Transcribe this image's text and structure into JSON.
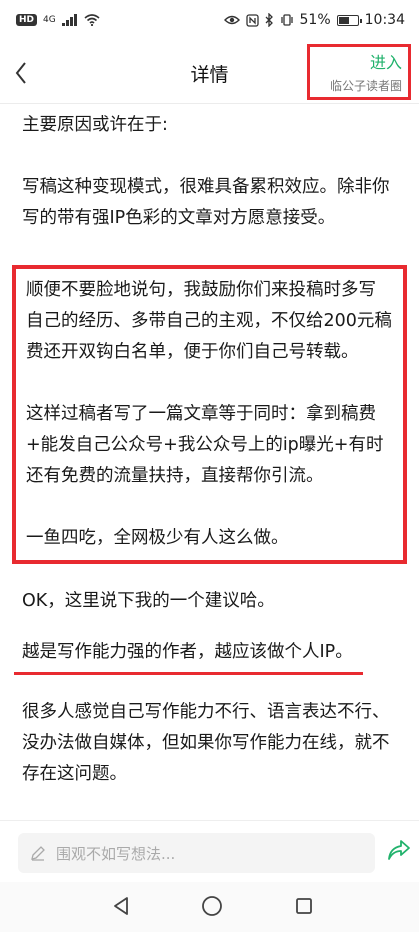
{
  "status_bar": {
    "hd": "HD",
    "network": "4G",
    "battery_percent": "51%",
    "time": "10:34"
  },
  "header": {
    "title": "详情",
    "enter_label": "进入",
    "circle_name": "临公子读者圈"
  },
  "article": {
    "p1": "主要原因或许在于:",
    "p2": "写稿这种变现模式，很难具备累积效应。除非你写的带有强IP色彩的文章对方愿意接受。",
    "highlight": [
      "顺便不要脸地说句，我鼓励你们来投稿时多写自己的经历、多带自己的主观，不仅给200元稿费还开双钩白名单，便于你们自己号转载。",
      "这样过稿者写了一篇文章等于同时：拿到稿费+能发自己公众号+我公众号上的ip曝光+有时还有免费的流量扶持，直接帮你引流。",
      "一鱼四吃，全网极少有人这么做。"
    ],
    "p3": "OK，这里说下我的一个建议哈。",
    "p4_underlined": "越是写作能力强的作者，越应该做个人IP。",
    "p5": "很多人感觉自己写作能力不行、语言表达不行、没办法做自媒体，但如果你写作能力在线，就不存在这问题。"
  },
  "comment_bar": {
    "placeholder": "围观不如写想法..."
  },
  "colors": {
    "accent_green": "#21b26c",
    "annotation_red": "#e82a30"
  },
  "icons": {
    "back": "chevron-left-icon",
    "pencil": "pencil-icon",
    "share": "share-arrow-icon",
    "nav_back": "triangle-back-icon",
    "nav_home": "circle-home-icon",
    "nav_recent": "square-recent-icon"
  }
}
